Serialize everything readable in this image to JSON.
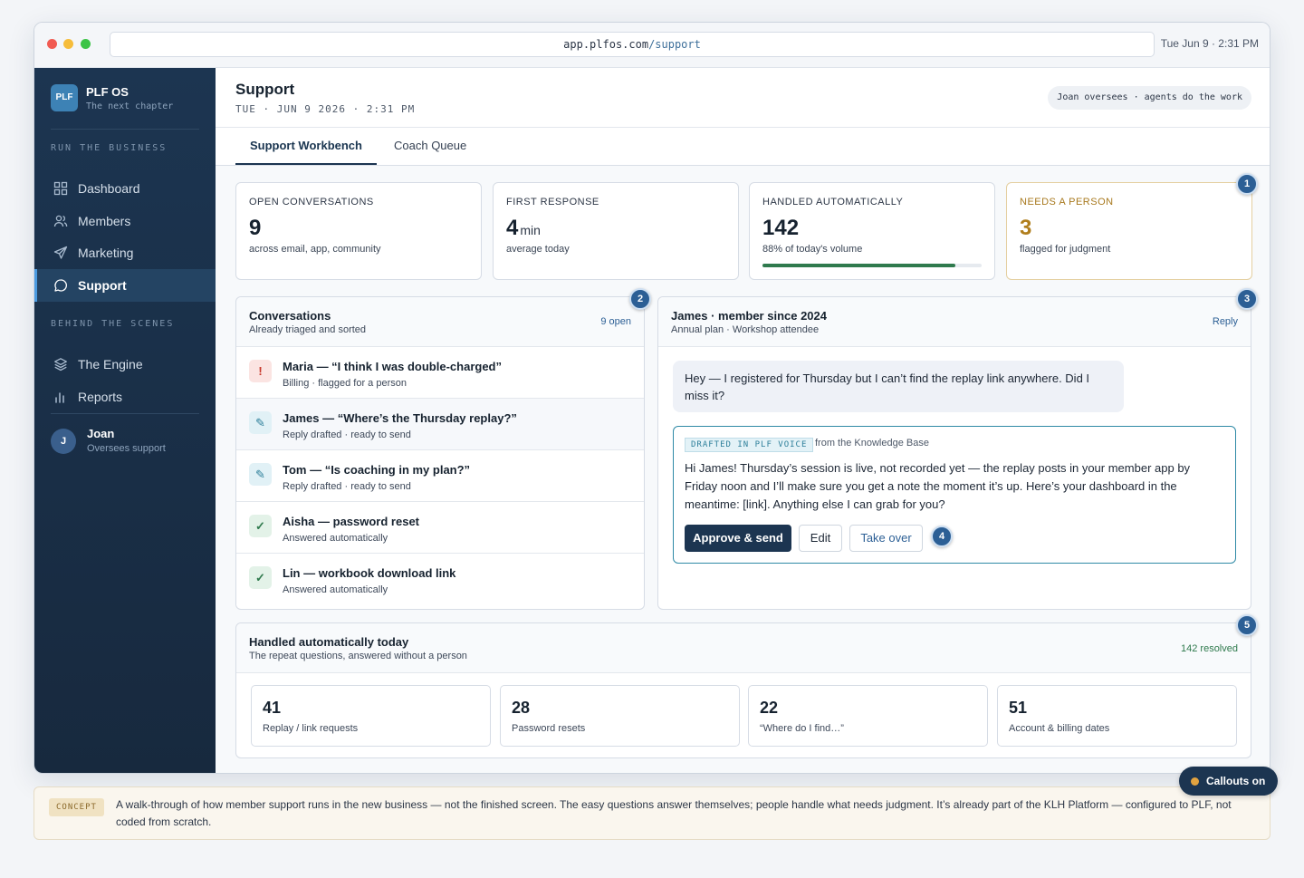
{
  "browser": {
    "url_host": "app.plfos.com",
    "url_path": "/support",
    "clock": "Tue Jun 9 · 2:31 PM",
    "dots": [
      "#f15b52",
      "#f6bd3b",
      "#3cc447"
    ]
  },
  "sidebar": {
    "logo": "PLF",
    "brand": "PLF OS",
    "tagline": "The next chapter",
    "section1": "RUN THE BUSINESS",
    "section2": "BEHIND THE SCENES",
    "items": [
      {
        "label": "Dashboard",
        "icon": "grid-icon"
      },
      {
        "label": "Members",
        "icon": "users-icon"
      },
      {
        "label": "Marketing",
        "icon": "send-icon"
      },
      {
        "label": "Support",
        "icon": "chat-icon",
        "active": true
      },
      {
        "label": "The Engine",
        "icon": "layers-icon"
      },
      {
        "label": "Reports",
        "icon": "bar-chart-icon"
      }
    ],
    "user": {
      "initial": "J",
      "name": "Joan",
      "role": "Oversees support"
    }
  },
  "header": {
    "title": "Support",
    "date": "TUE · JUN 9 2026 · 2:31 PM",
    "pill": "Joan oversees · agents do the work"
  },
  "tabs": [
    "Support Workbench",
    "Coach Queue"
  ],
  "kpis": [
    {
      "label": "OPEN CONVERSATIONS",
      "value": "9",
      "unit": "",
      "sub": "across email, app, community"
    },
    {
      "label": "FIRST RESPONSE",
      "value": "4",
      "unit": "min",
      "sub": "average today"
    },
    {
      "label": "HANDLED AUTOMATICALLY",
      "value": "142",
      "unit": "",
      "sub": "88% of today's volume",
      "progress": 0.88
    },
    {
      "label": "NEEDS A PERSON",
      "value": "3",
      "unit": "",
      "sub": "flagged for judgment"
    }
  ],
  "callouts": [
    "1",
    "2",
    "3",
    "4",
    "5"
  ],
  "conversations": {
    "title": "Conversations",
    "subtitle": "Already triaged and sorted",
    "count": "9 open",
    "items": [
      {
        "title": "Maria — “I think I was double-charged”",
        "sub": "Billing · flagged for a person",
        "icon": "alert-icon",
        "glyph": "!"
      },
      {
        "title": "James — “Where’s the Thursday replay?”",
        "sub": "Reply drafted · ready to send",
        "icon": "pencil-icon",
        "glyph": "✎"
      },
      {
        "title": "Tom — “Is coaching in my plan?”",
        "sub": "Reply drafted · ready to send",
        "icon": "pencil-icon",
        "glyph": "✎"
      },
      {
        "title": "Aisha — password reset",
        "sub": "Answered automatically",
        "icon": "check-icon",
        "glyph": "✓"
      },
      {
        "title": "Lin — workbook download link",
        "sub": "Answered automatically",
        "icon": "check-icon",
        "glyph": "✓"
      }
    ]
  },
  "detail": {
    "title": "James · member since 2024",
    "subtitle": "Annual plan · Workshop attendee",
    "reply": "Reply",
    "message": "Hey — I registered for Thursday but I can’t find the replay link anywhere. Did I miss it?",
    "draft_tag": "DRAFTED IN PLF VOICE",
    "draft_source": "from the Knowledge Base",
    "draft_body": "Hi James! Thursday’s session is live, not recorded yet — the replay posts in your member app by Friday noon and I’ll make sure you get a note the moment it’s up. Here’s your dashboard in the meantime: [link]. Anything else I can grab for you?",
    "buttons": {
      "approve": "Approve & send",
      "edit": "Edit",
      "takeover": "Take over"
    }
  },
  "auto": {
    "title": "Handled automatically today",
    "subtitle": "The repeat questions, answered without a person",
    "resolved": "142 resolved",
    "stats": [
      {
        "value": "41",
        "label": "Replay / link requests"
      },
      {
        "value": "28",
        "label": "Password resets"
      },
      {
        "value": "22",
        "label": "“Where do I find…”"
      },
      {
        "value": "51",
        "label": "Account & billing dates"
      }
    ]
  },
  "concept": {
    "tag": "CONCEPT",
    "text": "A walk-through of how member support runs in the new business — not the finished screen. The easy questions answer themselves; people handle what needs judgment. It’s already part of the KLH Platform — configured to PLF, not coded from scratch."
  },
  "toggle": {
    "label": "Callouts on"
  }
}
